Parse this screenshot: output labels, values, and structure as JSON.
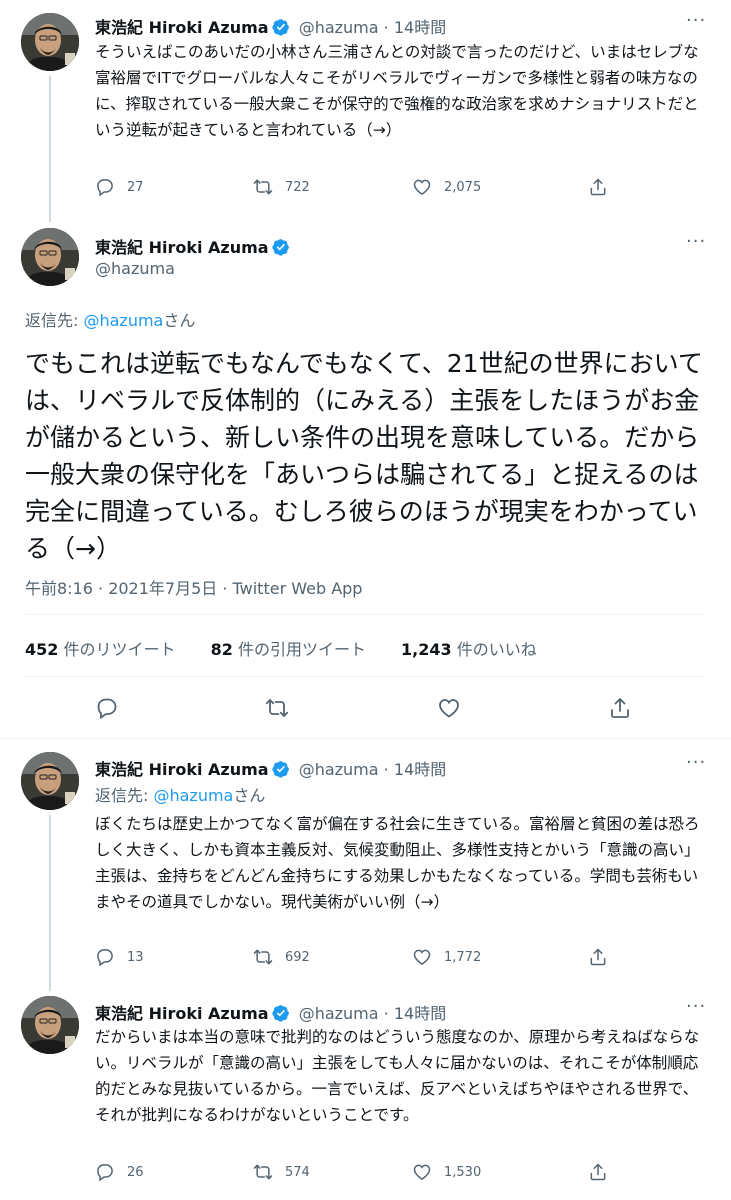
{
  "author": {
    "name": "東浩紀 Hiroki Azuma",
    "handle": "@hazuma"
  },
  "colors": {
    "accent": "#1d9bf0",
    "secondary_text": "#536471",
    "line": "#cfd9de"
  },
  "tweet1": {
    "separator": "·",
    "time": "14時間",
    "text": "そういえばこのあいだの小林さん三浦さんとの対談で言ったのだけど、いまはセレブな富裕層でITでグローバルな人々こそがリベラルでヴィーガンで多様性と弱者の味方なのに、搾取されている一般大衆こそが保守的で強権的な政治家を求めナショナリストだという逆転が起きていると言われている（→）",
    "replies": "27",
    "retweets": "722",
    "likes": "2,075"
  },
  "main_tweet": {
    "reply_prefix": "返信先: ",
    "reply_handle": "@hazuma",
    "reply_suffix": "さん",
    "text": "でもこれは逆転でもなんでもなくて、21世紀の世界においては、リベラルで反体制的（にみえる）主張をしたほうがお金が儲かるという、新しい条件の出現を意味している。だから一般大衆の保守化を「あいつらは騙されてる」と捉えるのは完全に間違っている。むしろ彼らのほうが現実をわかっている（→）",
    "timestamp": "午前8:16 · 2021年7月5日 · Twitter Web App",
    "retweet_count": "452",
    "retweet_label": " 件のリツイート",
    "quote_count": "82",
    "quote_label": " 件の引用ツイート",
    "like_count": "1,243",
    "like_label": " 件のいいね"
  },
  "tweet3": {
    "separator": "·",
    "time": "14時間",
    "reply_prefix": "返信先: ",
    "reply_handle": "@hazuma",
    "reply_suffix": "さん",
    "text": "ぼくたちは歴史上かつてなく富が偏在する社会に生きている。富裕層と貧困の差は恐ろしく大きく、しかも資本主義反対、気候変動阻止、多様性支持とかいう「意識の高い」主張は、金持ちをどんどん金持ちにする効果しかもたなくなっている。学問も芸術もいまやその道具でしかない。現代美術がいい例（→）",
    "replies": "13",
    "retweets": "692",
    "likes": "1,772"
  },
  "tweet4": {
    "separator": "·",
    "time": "14時間",
    "text": "だからいまは本当の意味で批判的なのはどういう態度なのか、原理から考えねばならない。リベラルが「意識の高い」主張をしても人々に届かないのは、それこそが体制順応的だとみな見抜いているから。一言でいえば、反アベといえばちやほやされる世界で、それが批判になるわけがないということです。",
    "replies": "26",
    "retweets": "574",
    "likes": "1,530"
  },
  "icons": [
    "verified-badge-icon",
    "more-icon",
    "reply-icon",
    "retweet-icon",
    "like-icon",
    "share-icon"
  ]
}
